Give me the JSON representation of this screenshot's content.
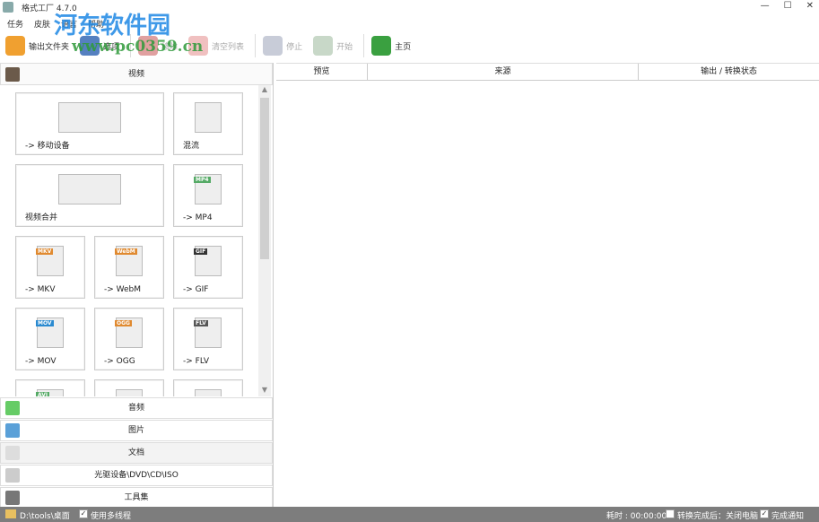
{
  "window": {
    "title": "格式工厂 4.7.0",
    "minimize": "—",
    "maximize": "☐",
    "close": "✕"
  },
  "menu": [
    "任务",
    "皮肤",
    "语言",
    "帮助"
  ],
  "watermark": {
    "name": "河东软件园",
    "url": "www.pc0359.cn"
  },
  "toolbar": [
    {
      "label": "输出文件夹",
      "icon": "folder-icon",
      "color": "#f0a030",
      "disabled": false
    },
    {
      "label": "选项",
      "icon": "gear-icon",
      "color": "#5580c0",
      "disabled": false
    },
    {
      "label": "移除",
      "icon": "remove-icon",
      "color": "#e0a0a0",
      "disabled": true
    },
    {
      "label": "清空列表",
      "icon": "clear-list-icon",
      "color": "#f0c0c0",
      "disabled": true
    },
    {
      "label": "停止",
      "icon": "stop-icon",
      "color": "#c8ccd8",
      "disabled": true
    },
    {
      "label": "开始",
      "icon": "start-icon",
      "color": "#c8d8c8",
      "disabled": true
    },
    {
      "label": "主页",
      "icon": "home-globe-icon",
      "color": "#3aa040",
      "disabled": false
    }
  ],
  "left": {
    "section": "视频",
    "tiles": [
      {
        "label": "-> 移动设备",
        "badge": "",
        "color": "#333"
      },
      {
        "label": "混流",
        "badge": "",
        "color": "#2a8a3a"
      },
      {
        "label": "视频合并",
        "badge": "",
        "color": "#f0a020"
      },
      {
        "label": "-> MP4",
        "badge": "MP4",
        "color": "#55aa66"
      },
      {
        "label": "-> MKV",
        "badge": "MKV",
        "color": "#e08a30"
      },
      {
        "label": "-> WebM",
        "badge": "WebM",
        "color": "#e08a30"
      },
      {
        "label": "-> GIF",
        "badge": "GIF",
        "color": "#333"
      },
      {
        "label": "-> MOV",
        "badge": "MOV",
        "color": "#2a8ad0"
      },
      {
        "label": "-> OGG",
        "badge": "OGG",
        "color": "#e08a30"
      },
      {
        "label": "-> FLV",
        "badge": "FLV",
        "color": "#555"
      },
      {
        "label": "",
        "badge": "AVI",
        "color": "#55aa66"
      },
      {
        "label": "",
        "badge": "",
        "color": "#55aa66"
      },
      {
        "label": "",
        "badge": "",
        "color": "#888833"
      }
    ],
    "categories": [
      {
        "label": "音频",
        "icon": "music-note-icon",
        "color": "#6c6"
      },
      {
        "label": "图片",
        "icon": "picture-icon",
        "color": "#5aa0d8"
      },
      {
        "label": "文档",
        "icon": "document-icon",
        "color": "#ddd"
      },
      {
        "label": "光驱设备\\DVD\\CD\\ISO",
        "icon": "disc-drive-icon",
        "color": "#ccc"
      },
      {
        "label": "工具集",
        "icon": "tools-reel-icon",
        "color": "#777"
      }
    ]
  },
  "table": {
    "columns": [
      "预览",
      "来源",
      "输出 / 转换状态"
    ]
  },
  "status": {
    "path": "D:\\tools\\桌面",
    "multithread": "使用多线程",
    "multithread_checked": "✓",
    "elapsed_label": "耗时 : 00:00:00",
    "shutdown": "转换完成后：关闭电脑",
    "notify": "完成通知",
    "notify_checked": "✓"
  }
}
